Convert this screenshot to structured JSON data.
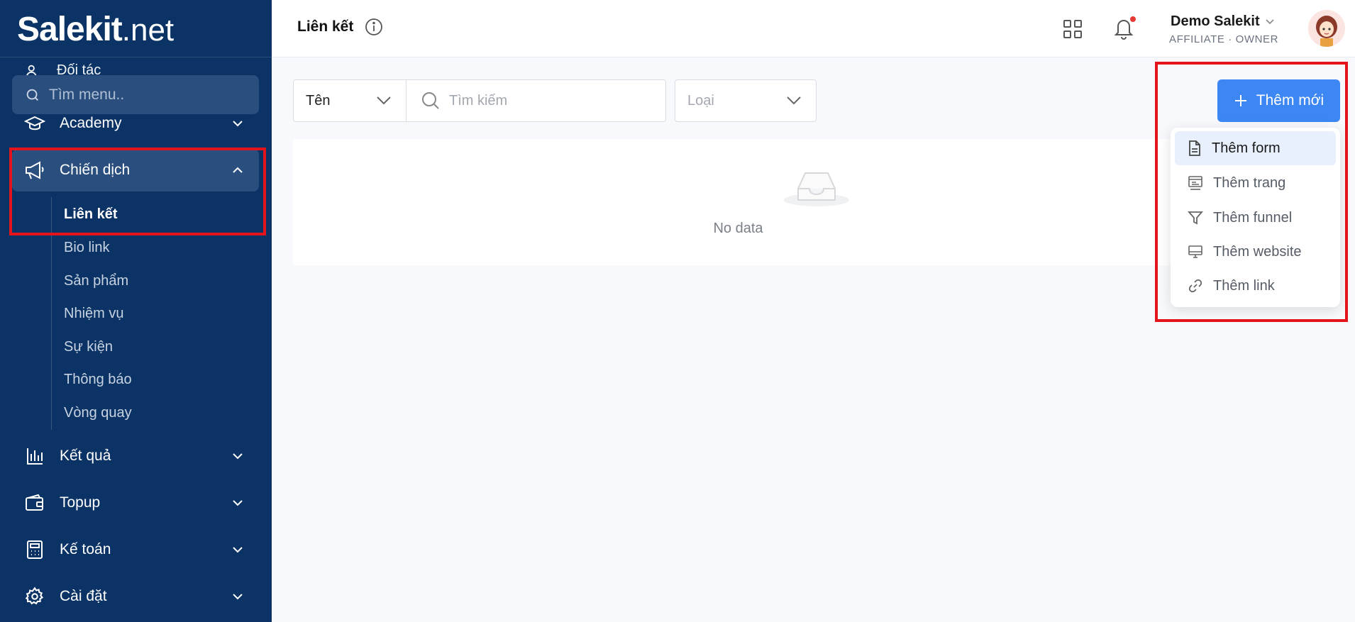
{
  "brand": {
    "logo_bold": "Salekit",
    "logo_light": ".net"
  },
  "sidebar": {
    "peek_label": "Đối tác",
    "search_placeholder": "Tìm menu..",
    "items": [
      {
        "label": "Academy",
        "icon": "graduation-cap-icon"
      },
      {
        "label": "Chiến dịch",
        "icon": "megaphone-icon"
      },
      {
        "label": "Kết quả",
        "icon": "bar-chart-icon"
      },
      {
        "label": "Topup",
        "icon": "wallet-icon"
      },
      {
        "label": "Kế toán",
        "icon": "calculator-icon"
      },
      {
        "label": "Cài đặt",
        "icon": "gear-icon"
      }
    ],
    "sub_items": [
      "Liên kết",
      "Bio link",
      "Sản phẩm",
      "Nhiệm vụ",
      "Sự kiện",
      "Thông báo",
      "Vòng quay"
    ]
  },
  "header": {
    "title": "Liên kết",
    "user_name": "Demo Salekit",
    "user_role": "AFFILIATE · OWNER"
  },
  "filters": {
    "field_select": "Tên",
    "search_placeholder": "Tìm kiếm",
    "type_placeholder": "Loại"
  },
  "empty": {
    "text": "No data"
  },
  "actions": {
    "add_label": "Thêm mới",
    "menu": [
      {
        "label": "Thêm form",
        "icon": "file-icon"
      },
      {
        "label": "Thêm trang",
        "icon": "page-icon"
      },
      {
        "label": "Thêm funnel",
        "icon": "funnel-icon"
      },
      {
        "label": "Thêm website",
        "icon": "monitor-icon"
      },
      {
        "label": "Thêm link",
        "icon": "link-icon"
      }
    ]
  },
  "colors": {
    "sidebar_bg": "#0b3366",
    "accent": "#3d87f5",
    "highlight_box": "#e3141b"
  }
}
